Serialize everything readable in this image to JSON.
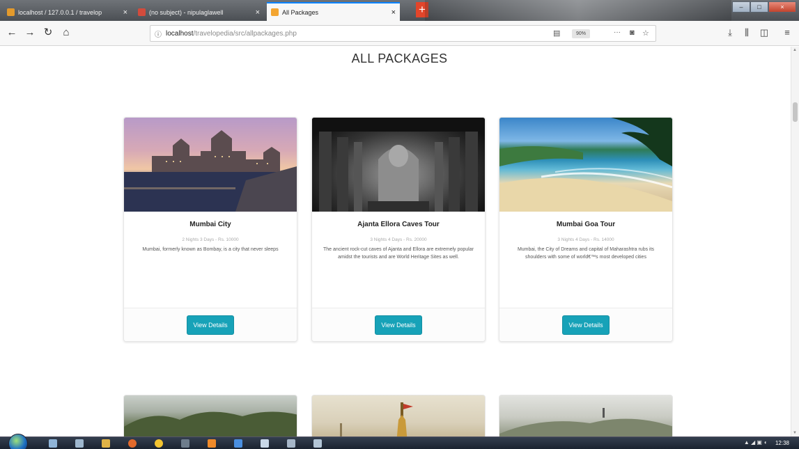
{
  "browser": {
    "tabs": [
      {
        "label": "localhost / 127.0.0.1 / travelop",
        "favicon_color": "#e39a2c",
        "active": false
      },
      {
        "label": "(no subject) - nipulaglawell",
        "favicon_color": "#d24b3c",
        "active": false
      },
      {
        "label": "All Packages",
        "favicon_color": "#f3a531",
        "active": true
      }
    ],
    "tab_close_glyph": "×",
    "new_tab_glyph": "+",
    "window_buttons": [
      "–",
      "□",
      "×"
    ],
    "url_host": "localhost",
    "url_path": "/travelopedia/src/allpackages.php",
    "zoom": "90%",
    "page_actions_glyph": "···",
    "nav_icons": {
      "back": "←",
      "forward": "→",
      "reload": "↻",
      "home": "⌂"
    },
    "toolbar_icons": [
      "download-icon",
      "library-icon",
      "sidebar-icon",
      "menu-icon"
    ]
  },
  "page": {
    "title": "ALL PACKAGES",
    "packages": [
      {
        "name": "Mumbai City",
        "meta": "2 Nights 3 Days - Rs. 10000",
        "description": "Mumbai, formerly known as Bombay, is a city that never sleeps",
        "button": "View Details",
        "image": "taj-hotel-dusk"
      },
      {
        "name": "Ajanta Ellora Caves Tour",
        "meta": "3 Nights 4 Days - Rs. 20000",
        "description": "The ancient rock-cut caves of Ajanta and Ellora are extremely popular amidst the tourists and are World Heritage Sites as well.",
        "button": "View Details",
        "image": "cave-interior"
      },
      {
        "name": "Mumbai Goa Tour",
        "meta": "3 Nights 4 Days - Rs. 14000",
        "description": "Mumbai, the City of Dreams and capital of Maharashtra rubs its shoulders with some of world€™s most developed cities",
        "button": "View Details",
        "image": "goa-beach"
      }
    ],
    "more_package_images": [
      "green-hills",
      "temple-spire",
      "hazy-mountain"
    ]
  },
  "taskbar": {
    "clock": "12:38",
    "tray": "▲ ◢ ▣ ◖"
  }
}
